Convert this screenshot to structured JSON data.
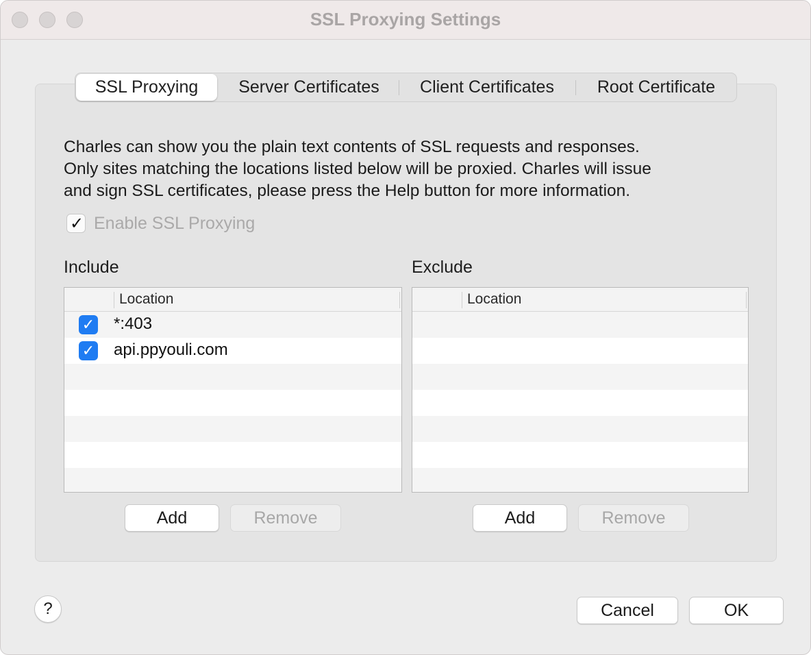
{
  "window": {
    "title": "SSL Proxying Settings"
  },
  "tabs": [
    {
      "label": "SSL Proxying",
      "active": true
    },
    {
      "label": "Server Certificates",
      "active": false
    },
    {
      "label": "Client Certificates",
      "active": false
    },
    {
      "label": "Root Certificate",
      "active": false
    }
  ],
  "description": {
    "line1": "Charles can show you the plain text contents of SSL requests and responses.",
    "line2": "Only sites matching the locations listed below will be proxied. Charles will issue",
    "line3": "and sign SSL certificates, please press the Help button for more information."
  },
  "enable_ssl": {
    "label": "Enable SSL Proxying",
    "checked": true,
    "check_glyph": "✓"
  },
  "include": {
    "label": "Include",
    "column_header": "Location",
    "rows": [
      {
        "checked": true,
        "location": "*:403"
      },
      {
        "checked": true,
        "location": "api.ppyouli.com"
      }
    ],
    "add_label": "Add",
    "remove_label": "Remove"
  },
  "exclude": {
    "label": "Exclude",
    "column_header": "Location",
    "rows": [],
    "add_label": "Add",
    "remove_label": "Remove"
  },
  "footer": {
    "help_label": "?",
    "cancel_label": "Cancel",
    "ok_label": "OK"
  },
  "colors": {
    "checkbox_accent": "#1f7cf2",
    "window_bg": "#ececec"
  }
}
